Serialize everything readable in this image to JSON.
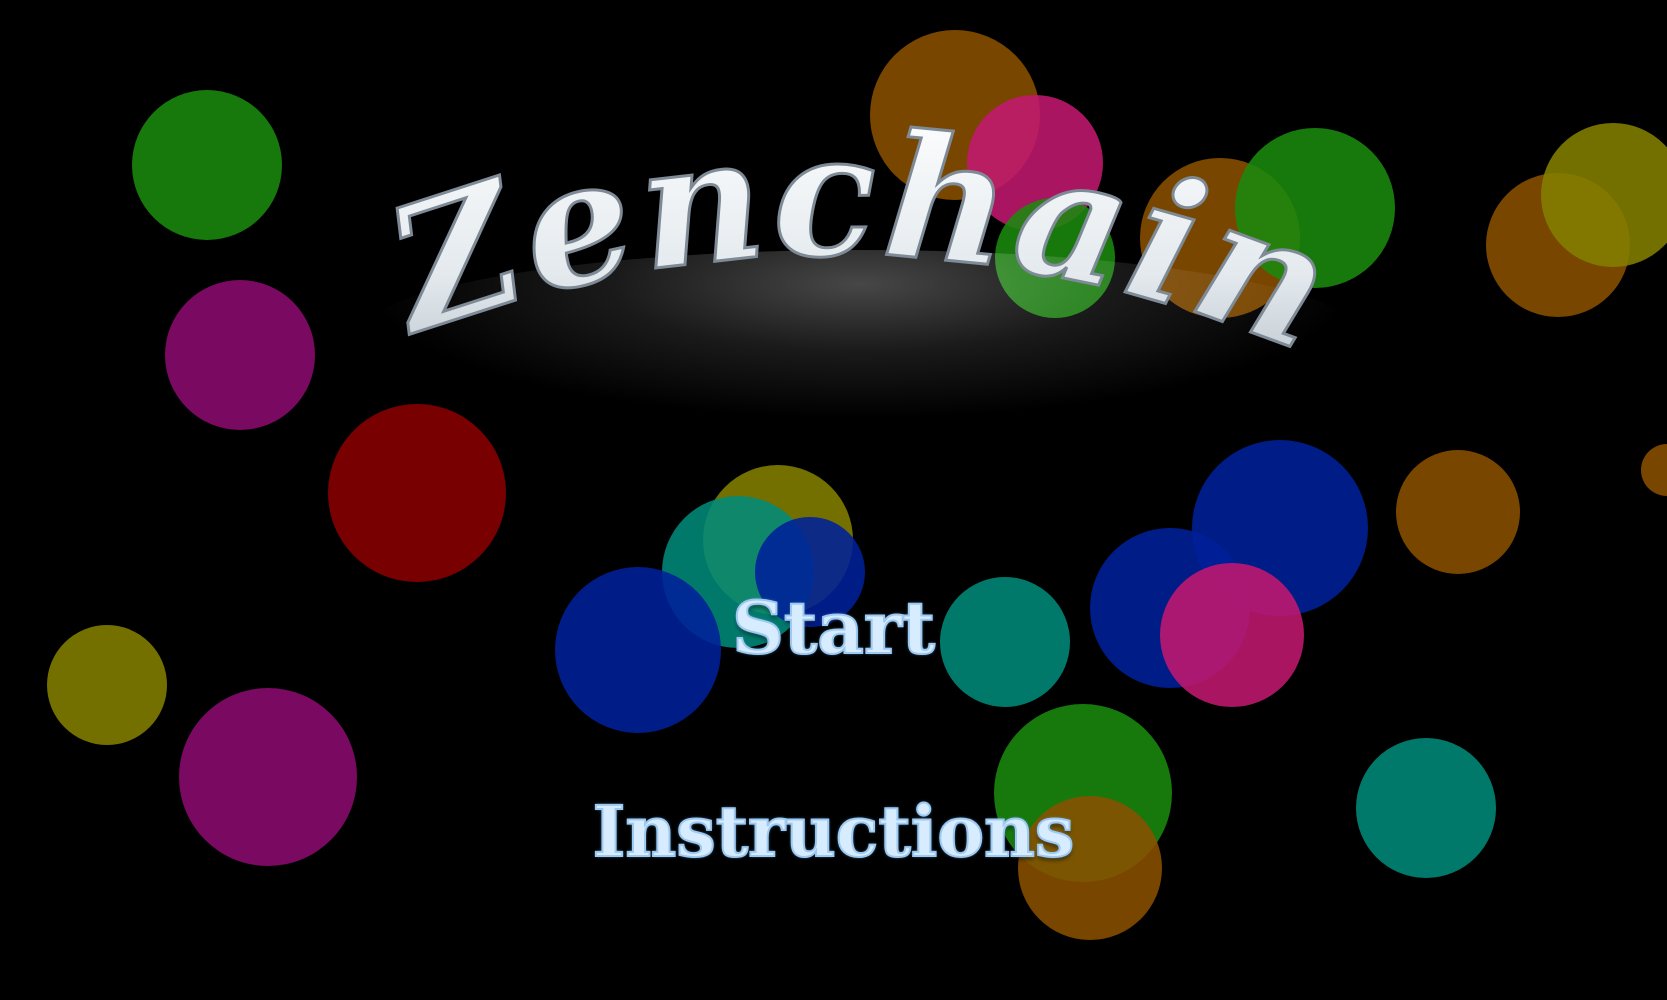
{
  "game": {
    "title": "Zenchain",
    "menu": {
      "start_label": "Start",
      "instructions_label": "Instructions"
    }
  },
  "colors": {
    "background": "#000000",
    "title_fill": "#e9eef2",
    "title_stroke": "#8b97a3",
    "menu_text": "#d8ecff",
    "bubble_palette": [
      "#1a8a0e",
      "#8a0a6e",
      "#8a0000",
      "#838000",
      "#8a5000",
      "#00209a",
      "#008a7a",
      "#c2186f"
    ]
  }
}
